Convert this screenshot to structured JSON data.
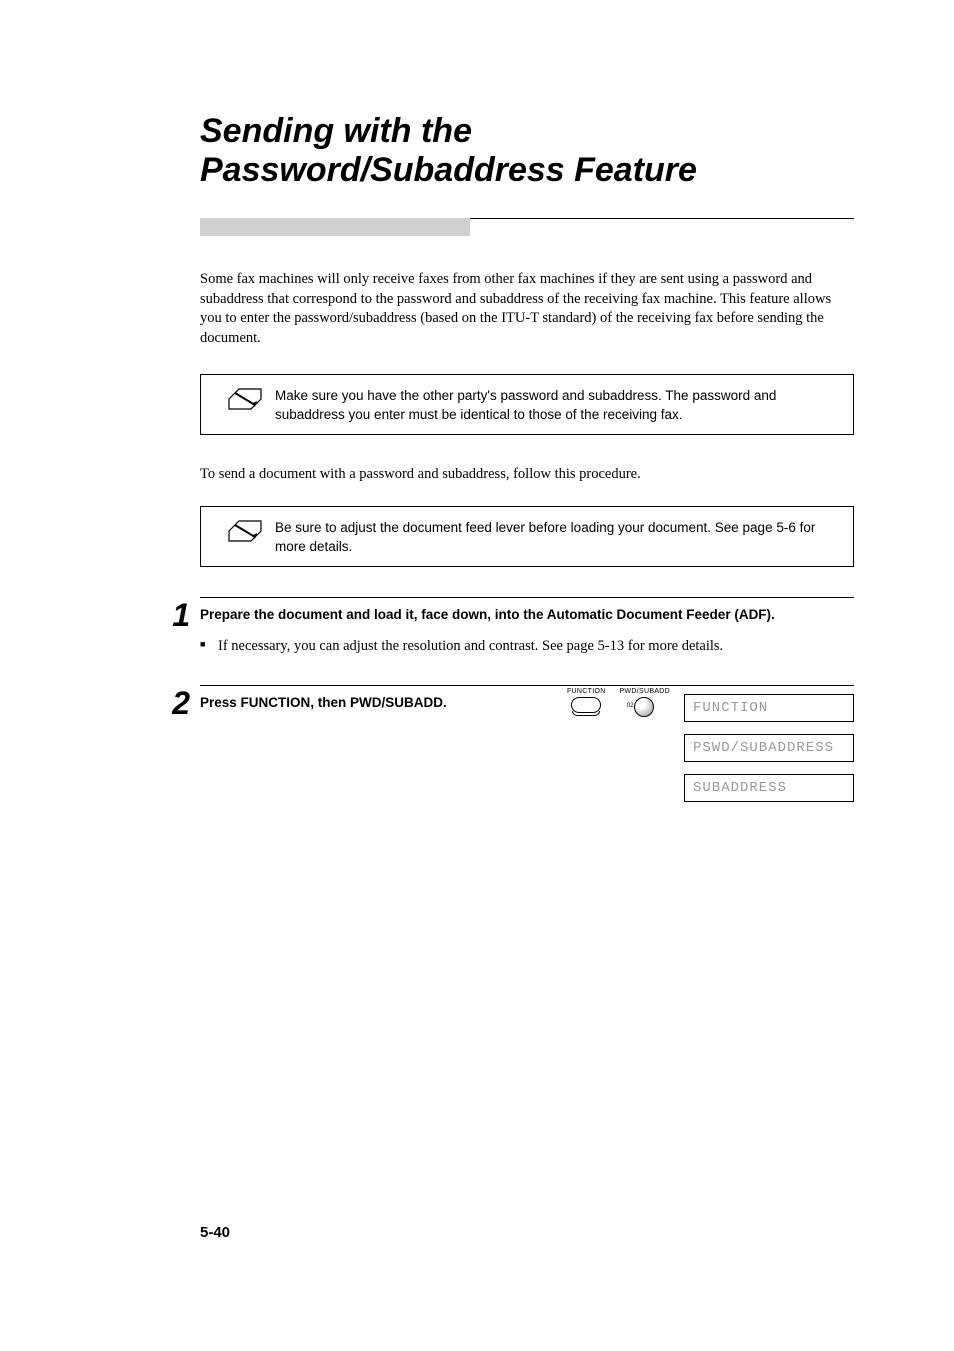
{
  "title_line1": "Sending with the",
  "title_line2": "Password/Subaddress Feature",
  "intro": "Some fax machines will only receive faxes from other fax machines if they are sent using a password and subaddress that correspond to the password and subaddress of the receiving fax machine. This feature allows you to enter the password/subaddress (based on the ITU-T standard) of the receiving fax before sending the document.",
  "note1": "Make sure you have the other party's password and subaddress. The password and subaddress you enter must be identical to those of the receiving fax.",
  "instr": "To send a document with a password and subaddress, follow this procedure.",
  "note2": "Be sure to adjust the document feed lever before loading your document. See page 5-6 for more details.",
  "steps": {
    "1": {
      "num": "1",
      "heading": "Prepare the document and load it, face down, into the Automatic Document Feeder (ADF).",
      "sub": "If necessary, you can adjust the resolution and contrast. See page 5-13 for more details."
    },
    "2": {
      "num": "2",
      "heading": "Press FUNCTION, then PWD/SUBADD.",
      "btn1_label": "FUNCTION",
      "btn2_label": "PWD/SUBADD",
      "btn2_small": "02"
    }
  },
  "lcd": {
    "l1": "FUNCTION",
    "l2": "PSWD/SUBADDRESS",
    "l3": "SUBADDRESS"
  },
  "page_num": "5-40"
}
